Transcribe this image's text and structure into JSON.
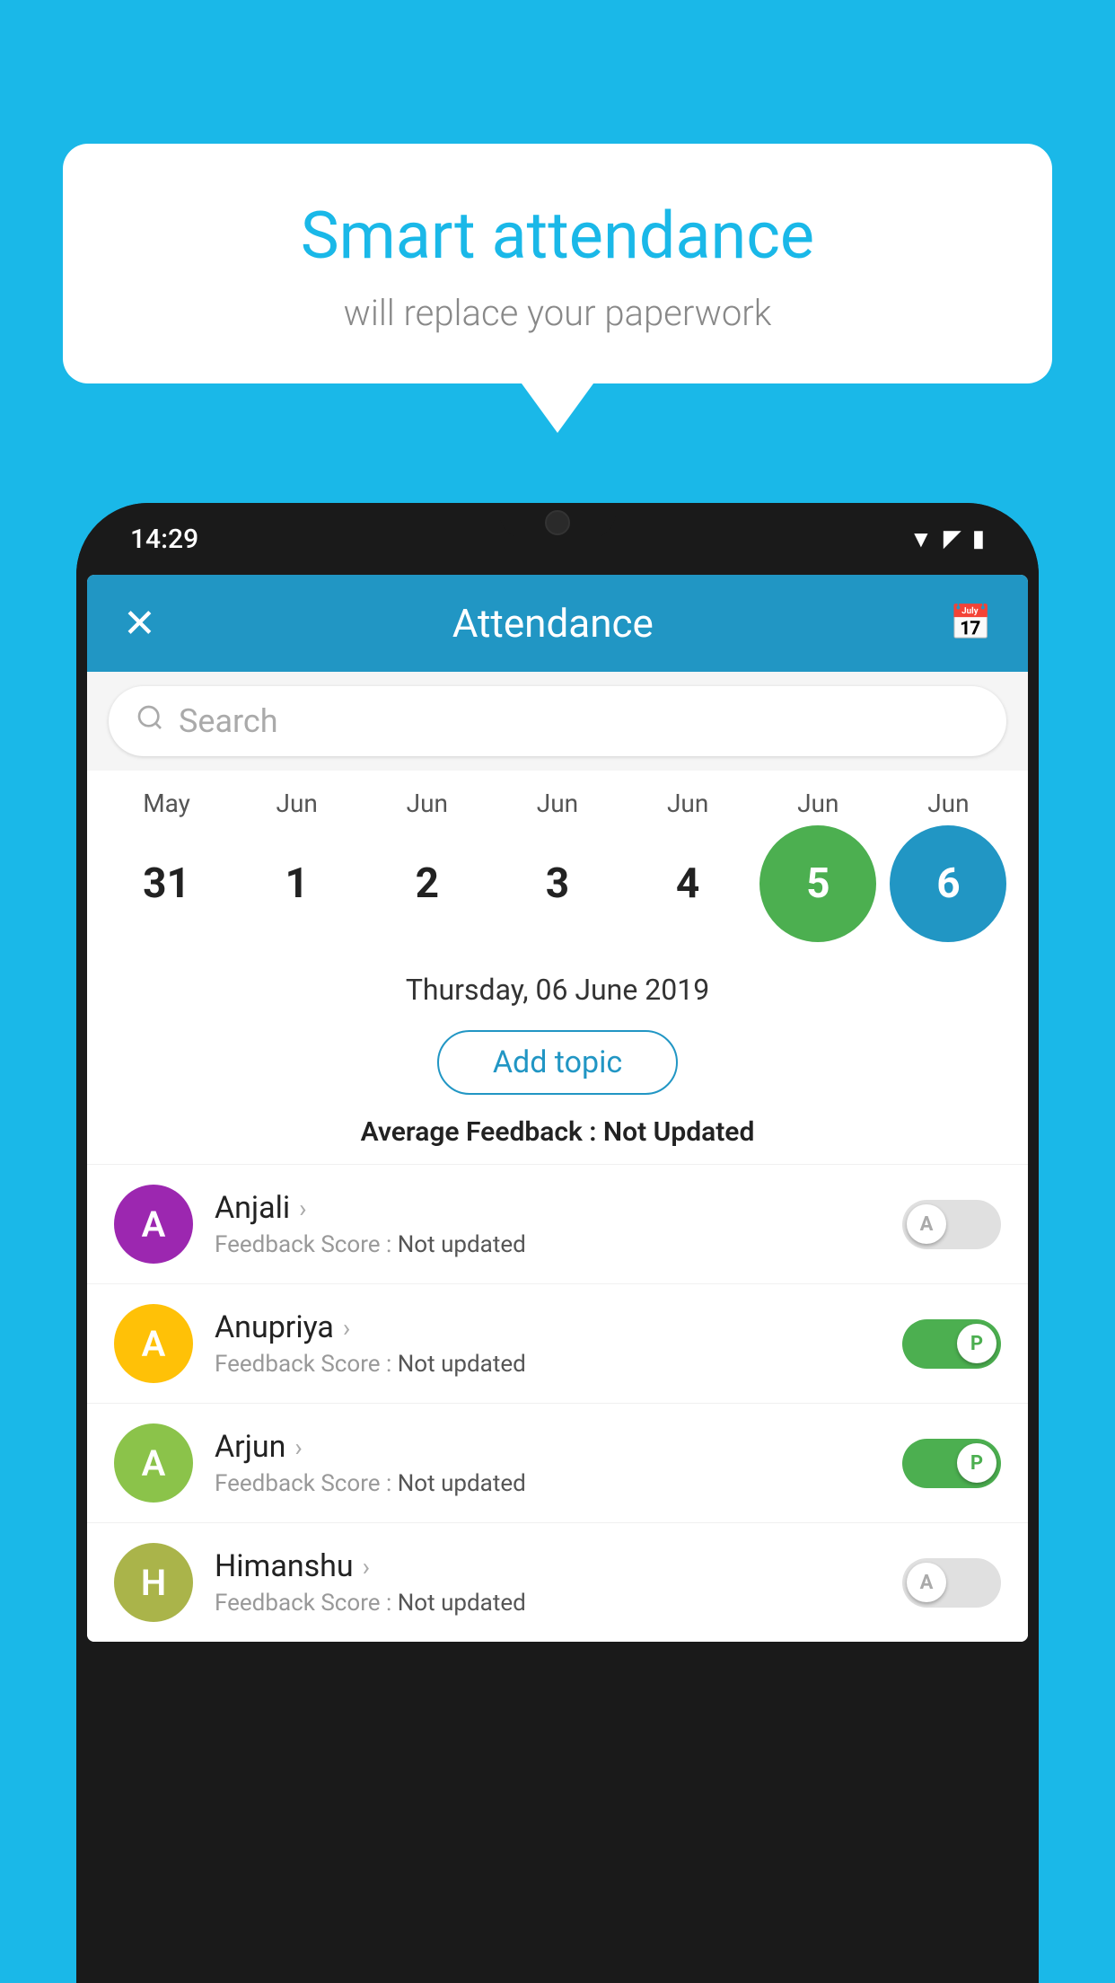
{
  "background_color": "#1ab8e8",
  "speech_bubble": {
    "title": "Smart attendance",
    "subtitle": "will replace your paperwork"
  },
  "phone": {
    "time": "14:29",
    "app_title": "Attendance",
    "search_placeholder": "Search",
    "selected_date_display": "Thursday, 06 June 2019",
    "add_topic_label": "Add topic",
    "avg_feedback_label": "Average Feedback :",
    "avg_feedback_value": "Not Updated",
    "calendar": {
      "months": [
        "May",
        "Jun",
        "Jun",
        "Jun",
        "Jun",
        "Jun",
        "Jun"
      ],
      "days": [
        "31",
        "1",
        "2",
        "3",
        "4",
        "5",
        "6"
      ],
      "active_green_index": 5,
      "active_blue_index": 6
    },
    "students": [
      {
        "name": "Anjali",
        "avatar_letter": "A",
        "avatar_color": "purple",
        "feedback_score_label": "Feedback Score :",
        "feedback_score_value": "Not updated",
        "toggle_state": "off",
        "toggle_label": "A"
      },
      {
        "name": "Anupriya",
        "avatar_letter": "A",
        "avatar_color": "yellow",
        "feedback_score_label": "Feedback Score :",
        "feedback_score_value": "Not updated",
        "toggle_state": "on",
        "toggle_label": "P"
      },
      {
        "name": "Arjun",
        "avatar_letter": "A",
        "avatar_color": "green",
        "feedback_score_label": "Feedback Score :",
        "feedback_score_value": "Not updated",
        "toggle_state": "on",
        "toggle_label": "P"
      },
      {
        "name": "Himanshu",
        "avatar_letter": "H",
        "avatar_color": "khaki",
        "feedback_score_label": "Feedback Score :",
        "feedback_score_value": "Not updated",
        "toggle_state": "off",
        "toggle_label": "A"
      }
    ]
  }
}
